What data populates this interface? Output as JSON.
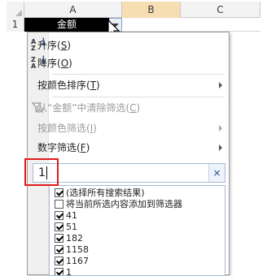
{
  "sheet": {
    "columns": [
      "A",
      "B",
      "C"
    ],
    "row_number": "1",
    "cell_a1": "金额"
  },
  "menu": {
    "items": [
      {
        "label": "升序",
        "shortcut": "S",
        "icon": "sort-ascending-icon",
        "icon_letters": "A\nZ"
      },
      {
        "label": "降序",
        "shortcut": "O",
        "icon": "sort-descending-icon",
        "icon_letters": "Z\nA"
      },
      {
        "label": "按颜色排序",
        "shortcut": "T",
        "submenu": true
      },
      {
        "label": "从“金额”中清除筛选",
        "shortcut": "C",
        "disabled": true,
        "icon": "clear-filter-icon"
      },
      {
        "label": "按颜色筛选",
        "shortcut": "I",
        "disabled": true,
        "submenu": true
      },
      {
        "label": "数字筛选",
        "shortcut": "F",
        "submenu": true
      }
    ]
  },
  "search": {
    "value": "1",
    "clear_label": "×"
  },
  "list": {
    "items": [
      {
        "label": "(选择所有搜索结果)",
        "checked": true
      },
      {
        "label": "将当前所选内容添加到筛选器",
        "checked": false
      },
      {
        "label": "41",
        "checked": true
      },
      {
        "label": "51",
        "checked": true
      },
      {
        "label": "182",
        "checked": true
      },
      {
        "label": "1158",
        "checked": true
      },
      {
        "label": "1167",
        "checked": true
      },
      {
        "label": "1",
        "checked": true
      }
    ]
  },
  "colors": {
    "highlight_red": "#e11b1b",
    "selected_column": "#f6ddb2"
  }
}
